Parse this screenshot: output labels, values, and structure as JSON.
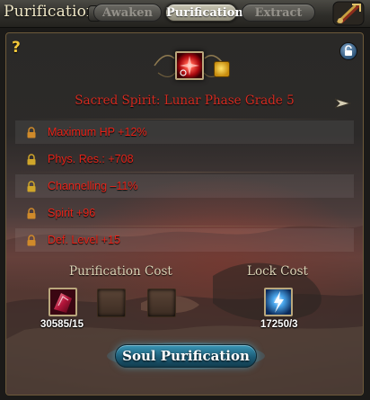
{
  "window": {
    "title": "Purification"
  },
  "tabs": [
    {
      "label": "Awaken",
      "active": false
    },
    {
      "label": "Purification",
      "active": true
    },
    {
      "label": "Extract",
      "active": false
    }
  ],
  "panel": {
    "help_icon": "?",
    "item": {
      "icon": "red-burst-spirit-icon",
      "name": "Sacred Spirit: Lunar Phase Grade 5"
    },
    "stats": [
      {
        "text": "Maximum HP +12%",
        "lock_color": "#d08a2a"
      },
      {
        "text": "Phys. Res.: +708",
        "lock_color": "#d0a62a"
      },
      {
        "text": "Channelling –11%",
        "lock_color": "#d0a62a"
      },
      {
        "text": "Spirit +96",
        "lock_color": "#d08a2a"
      },
      {
        "text": "Def. Level +15",
        "lock_color": "#d08a2a"
      }
    ],
    "purification_cost": {
      "label": "Purification Cost",
      "material_icon": "red-crystal-material-icon",
      "count": "30585/15"
    },
    "lock_cost": {
      "label": "Lock Cost",
      "material_icon": "blue-lightning-material-icon",
      "count": "17250/3"
    },
    "button": {
      "label": "Soul Purification"
    }
  },
  "colors": {
    "stat_text": "#e8241a",
    "item_name": "#d32b20",
    "button": "#1c5d78",
    "help": "#f2c73a"
  }
}
